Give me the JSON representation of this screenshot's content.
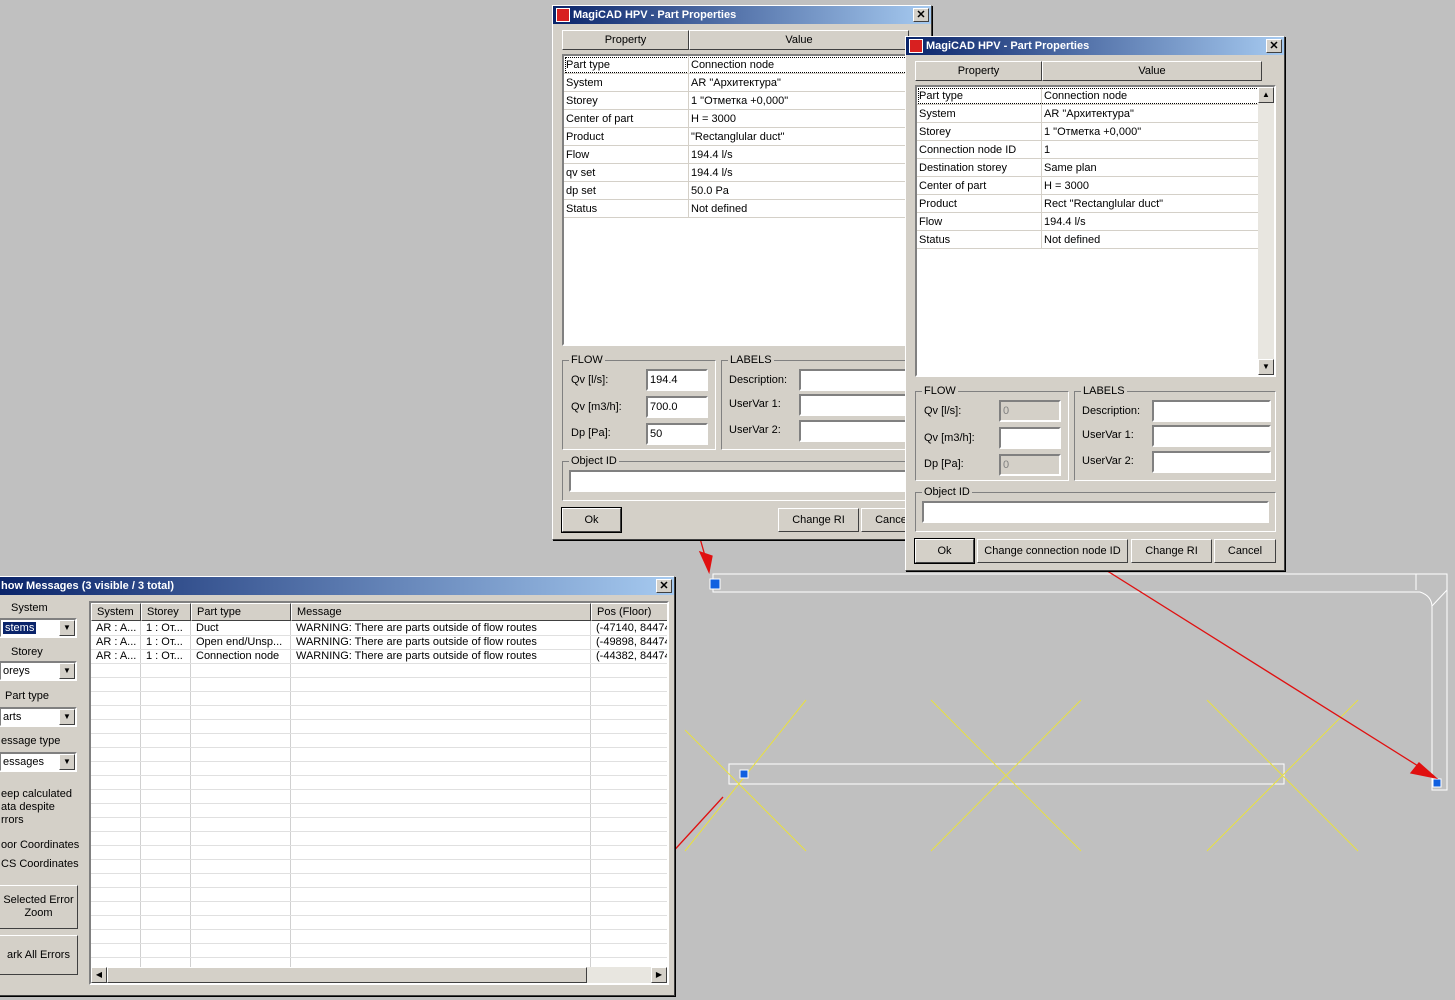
{
  "dialog1": {
    "title": "MagiCAD HPV - Part Properties",
    "col_property": "Property",
    "col_value": "Value",
    "rows": [
      {
        "property": "Part type",
        "value": "Connection node"
      },
      {
        "property": "System",
        "value": "AR \"Архитектура\""
      },
      {
        "property": "Storey",
        "value": "1 \"Отметка +0,000\""
      },
      {
        "property": "Center of part",
        "value": "H = 3000"
      },
      {
        "property": "Product",
        "value": " \"Rectanglular duct\""
      },
      {
        "property": "Flow",
        "value": "194.4 l/s"
      },
      {
        "property": "qv set",
        "value": "194.4 l/s"
      },
      {
        "property": "dp set",
        "value": "50.0 Pa"
      },
      {
        "property": "Status",
        "value": "Not defined"
      }
    ],
    "flow_title": "FLOW",
    "qv_ls_label": "Qv [l/s]:",
    "qv_ls_value": "194.4",
    "qv_m3h_label": "Qv [m3/h]:",
    "qv_m3h_value": "700.0",
    "dp_label": "Dp [Pa]:",
    "dp_value": "50",
    "labels_title": "LABELS",
    "description_label": "Description:",
    "uservar1_label": "UserVar 1:",
    "uservar2_label": "UserVar 2:",
    "object_id_title": "Object ID",
    "ok_label": "Ok",
    "change_ri_label": "Change RI",
    "cancel_label": "Cance"
  },
  "dialog2": {
    "title": "MagiCAD HPV - Part Properties",
    "col_property": "Property",
    "col_value": "Value",
    "rows": [
      {
        "property": "Part type",
        "value": "Connection node"
      },
      {
        "property": "System",
        "value": "AR \"Архитектура\""
      },
      {
        "property": "Storey",
        "value": "1 \"Отметка +0,000\""
      },
      {
        "property": "Connection node ID",
        "value": "1"
      },
      {
        "property": "Destination storey",
        "value": "Same plan"
      },
      {
        "property": "Center of part",
        "value": "H = 3000"
      },
      {
        "property": "Product",
        "value": "Rect \"Rectanglular duct\""
      },
      {
        "property": "Flow",
        "value": "194.4 l/s"
      },
      {
        "property": "Status",
        "value": "Not defined"
      }
    ],
    "flow_title": "FLOW",
    "qv_ls_label": "Qv [l/s]:",
    "qv_ls_value": "0",
    "qv_m3h_label": "Qv [m3/h]:",
    "qv_m3h_value": "",
    "dp_label": "Dp [Pa]:",
    "dp_value": "0",
    "labels_title": "LABELS",
    "description_label": "Description:",
    "uservar1_label": "UserVar 1:",
    "uservar2_label": "UserVar 2:",
    "object_id_title": "Object ID",
    "ok_label": "Ok",
    "change_node_label": "Change connection node ID",
    "change_ri_label": "Change RI",
    "cancel_label": "Cancel"
  },
  "messages": {
    "title": "how Messages   (3 visible / 3 total)",
    "system_label": "System",
    "system_value": "stems",
    "storey_label": "Storey",
    "storey_value": "oreys",
    "part_type_label": "Part type",
    "part_type_value": "arts",
    "message_type_label": "essage type",
    "message_type_value": "essages",
    "keep_calc_label": "eep calculated\nata despite\nrrors",
    "floor_coords_label": "oor Coordinates",
    "cs_coords_label": "CS Coordinates",
    "selected_error_btn": "Selected Error\nZoom",
    "mark_all_btn": "ark All Errors",
    "columns": [
      "System",
      "Storey",
      "Part type",
      "Message",
      "Pos (Floor)"
    ],
    "rows": [
      [
        "AR : A...",
        "1 : От...",
        "Duct",
        "WARNING: There are parts outside of flow routes",
        "(-47140, 84474"
      ],
      [
        "AR : A...",
        "1 : От...",
        "Open end/Unsp...",
        "WARNING: There are parts outside of flow routes",
        "(-49898, 84474"
      ],
      [
        "AR : A...",
        "1 : От...",
        "Connection node",
        "WARNING: There are parts outside of flow routes",
        "(-44382, 84474"
      ]
    ]
  },
  "colors": {
    "titlebar_start": "#0a246a",
    "titlebar_end": "#a6caf0",
    "dialog_face": "#d4d0c8",
    "canvas_bg": "#c0c0c0",
    "cad_lines": "#ffffff",
    "cad_cross": "#e8e040",
    "annotation_arrow": "#e01010",
    "grip": "#1060e0"
  }
}
